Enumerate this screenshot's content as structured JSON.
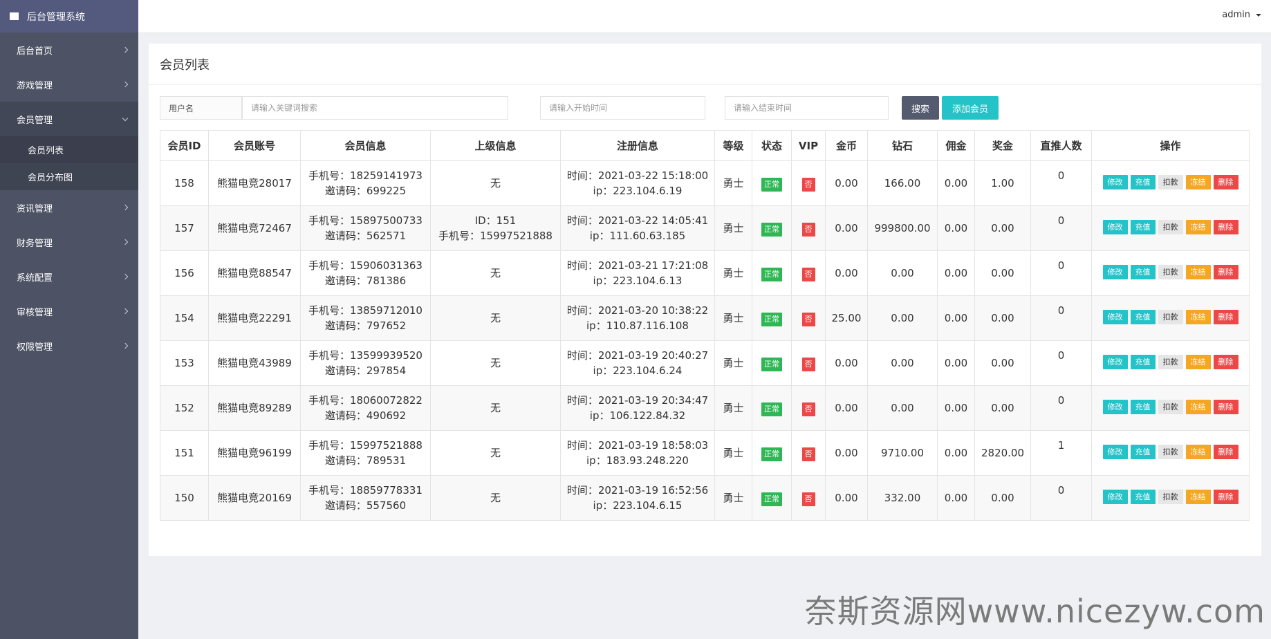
{
  "app": {
    "title": "后台管理系统"
  },
  "topbar": {
    "user": "admin"
  },
  "sidebar": {
    "items": [
      {
        "label": "后台首页"
      },
      {
        "label": "游戏管理"
      },
      {
        "label": "会员管理",
        "subitems": [
          {
            "label": "会员列表"
          },
          {
            "label": "会员分布图"
          }
        ]
      },
      {
        "label": "资讯管理"
      },
      {
        "label": "财务管理"
      },
      {
        "label": "系统配置"
      },
      {
        "label": "审核管理"
      },
      {
        "label": "权限管理"
      }
    ]
  },
  "panel": {
    "title": "会员列表"
  },
  "search": {
    "field_label": "用户名",
    "keyword_placeholder": "请输入关键词搜索",
    "start_placeholder": "请输入开始时间",
    "end_placeholder": "请输入结束时间",
    "search_label": "搜索",
    "add_label": "添加会员"
  },
  "table": {
    "headers": [
      "会员ID",
      "会员账号",
      "会员信息",
      "上级信息",
      "注册信息",
      "等级",
      "状态",
      "VIP",
      "金币",
      "钻石",
      "佣金",
      "奖金",
      "直推人数",
      "操作"
    ],
    "ops": [
      "修改",
      "充值",
      "扣款",
      "冻结",
      "删除"
    ],
    "rows": [
      {
        "id": "158",
        "account": "熊猫电竞28017",
        "phone": "手机号：18259141973",
        "invite": "邀请码：699225",
        "parent1": "无",
        "parent2": "",
        "reg_time": "时间：2021-03-22 15:18:00",
        "reg_ip": "ip：223.104.6.19",
        "level": "勇士",
        "status": "正常",
        "vip": "否",
        "gold": "0.00",
        "diamond": "166.00",
        "commission": "0.00",
        "bonus": "1.00",
        "direct": "0"
      },
      {
        "id": "157",
        "account": "熊猫电竞72467",
        "phone": "手机号：15897500733",
        "invite": "邀请码：562571",
        "parent1": "ID：151",
        "parent2": "手机号：15997521888",
        "reg_time": "时间：2021-03-22 14:05:41",
        "reg_ip": "ip：111.60.63.185",
        "level": "勇士",
        "status": "正常",
        "vip": "否",
        "gold": "0.00",
        "diamond": "999800.00",
        "commission": "0.00",
        "bonus": "0.00",
        "direct": "0"
      },
      {
        "id": "156",
        "account": "熊猫电竞88547",
        "phone": "手机号：15906031363",
        "invite": "邀请码：781386",
        "parent1": "无",
        "parent2": "",
        "reg_time": "时间：2021-03-21 17:21:08",
        "reg_ip": "ip：223.104.6.13",
        "level": "勇士",
        "status": "正常",
        "vip": "否",
        "gold": "0.00",
        "diamond": "0.00",
        "commission": "0.00",
        "bonus": "0.00",
        "direct": "0"
      },
      {
        "id": "154",
        "account": "熊猫电竞22291",
        "phone": "手机号：13859712010",
        "invite": "邀请码：797652",
        "parent1": "无",
        "parent2": "",
        "reg_time": "时间：2021-03-20 10:38:22",
        "reg_ip": "ip：110.87.116.108",
        "level": "勇士",
        "status": "正常",
        "vip": "否",
        "gold": "25.00",
        "diamond": "0.00",
        "commission": "0.00",
        "bonus": "0.00",
        "direct": "0"
      },
      {
        "id": "153",
        "account": "熊猫电竞43989",
        "phone": "手机号：13599939520",
        "invite": "邀请码：297854",
        "parent1": "无",
        "parent2": "",
        "reg_time": "时间：2021-03-19 20:40:27",
        "reg_ip": "ip：223.104.6.24",
        "level": "勇士",
        "status": "正常",
        "vip": "否",
        "gold": "0.00",
        "diamond": "0.00",
        "commission": "0.00",
        "bonus": "0.00",
        "direct": "0"
      },
      {
        "id": "152",
        "account": "熊猫电竞89289",
        "phone": "手机号：18060072822",
        "invite": "邀请码：490692",
        "parent1": "无",
        "parent2": "",
        "reg_time": "时间：2021-03-19 20:34:47",
        "reg_ip": "ip：106.122.84.32",
        "level": "勇士",
        "status": "正常",
        "vip": "否",
        "gold": "0.00",
        "diamond": "0.00",
        "commission": "0.00",
        "bonus": "0.00",
        "direct": "0"
      },
      {
        "id": "151",
        "account": "熊猫电竞96199",
        "phone": "手机号：15997521888",
        "invite": "邀请码：789531",
        "parent1": "无",
        "parent2": "",
        "reg_time": "时间：2021-03-19 18:58:03",
        "reg_ip": "ip：183.93.248.220",
        "level": "勇士",
        "status": "正常",
        "vip": "否",
        "gold": "0.00",
        "diamond": "9710.00",
        "commission": "0.00",
        "bonus": "2820.00",
        "direct": "1"
      },
      {
        "id": "150",
        "account": "熊猫电竞20169",
        "phone": "手机号：18859778331",
        "invite": "邀请码：557560",
        "parent1": "无",
        "parent2": "",
        "reg_time": "时间：2021-03-19 16:52:56",
        "reg_ip": "ip：223.104.6.15",
        "level": "勇士",
        "status": "正常",
        "vip": "否",
        "gold": "0.00",
        "diamond": "332.00",
        "commission": "0.00",
        "bonus": "0.00",
        "direct": "0"
      }
    ]
  },
  "watermark": "奈斯资源网www.nicezyw.com"
}
